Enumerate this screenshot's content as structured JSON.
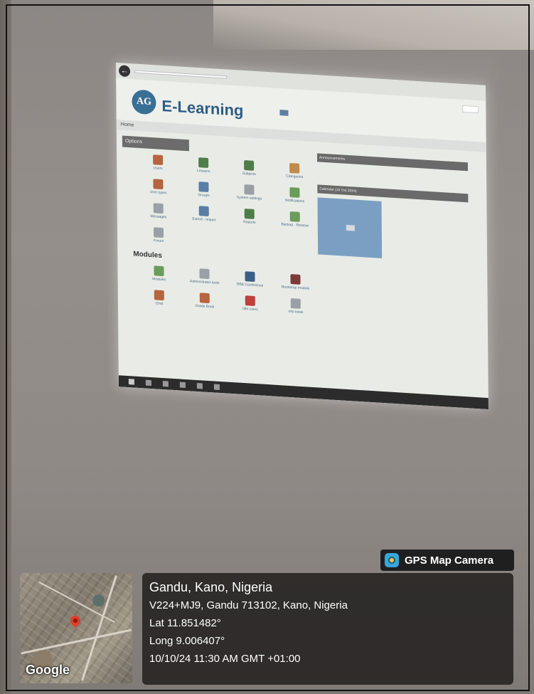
{
  "photo": {
    "description_colors": {
      "wall": "#8f8986",
      "screen": "#e9ece6",
      "accent": "#2e5d85"
    }
  },
  "projected_screen": {
    "brand": "E-Learning",
    "logo_text": "AG",
    "home_label": "Home",
    "options_label": "Options",
    "modules_label": "Modules",
    "icons": [
      {
        "label": "Users",
        "color": "#b5653f"
      },
      {
        "label": "Lessons",
        "color": "#4f7d4a"
      },
      {
        "label": "Subjects",
        "color": "#4f7d4a"
      },
      {
        "label": "Categories",
        "color": "#c28b47"
      },
      {
        "label": "User types",
        "color": "#b5653f"
      },
      {
        "label": "Groups",
        "color": "#5a7ea6"
      },
      {
        "label": "System settings",
        "color": "#9aa0a6"
      },
      {
        "label": "Notifications",
        "color": "#6a9c5a"
      },
      {
        "label": "Messages",
        "color": "#9aa0a6"
      },
      {
        "label": "Export - Import",
        "color": "#5a7ea6"
      },
      {
        "label": "Reports",
        "color": "#4f7d4a"
      },
      {
        "label": "Backup - Restore",
        "color": "#6a9c5a"
      },
      {
        "label": "Forum",
        "color": "#9aa0a6"
      }
    ],
    "module_icons": [
      {
        "label": "Modules",
        "color": "#6a9c5a"
      },
      {
        "label": "Administrator tools",
        "color": "#9aa0a6"
      },
      {
        "label": "BBB Conference",
        "color": "#3b5f86"
      },
      {
        "label": "Bootstrap module",
        "color": "#7a3b3b"
      },
      {
        "label": "Chat",
        "color": "#b5653f"
      },
      {
        "label": "Grade Book",
        "color": "#b5653f"
      },
      {
        "label": "Idle users",
        "color": "#c0403a"
      },
      {
        "label": "Info kiosk",
        "color": "#9aa0a6"
      }
    ],
    "announcements_label": "Announcements",
    "calendar_label": "Calendar (10 Oct 2024)"
  },
  "gps": {
    "badge_title": "GPS Map Camera",
    "place": "Gandu, Kano, Nigeria",
    "address": "V224+MJ9, Gandu 713102, Kano, Nigeria",
    "lat": "Lat 11.851482°",
    "long": "Long 9.006407°",
    "datetime": "10/10/24 11:30 AM GMT +01:00",
    "map_brand": "Google"
  }
}
